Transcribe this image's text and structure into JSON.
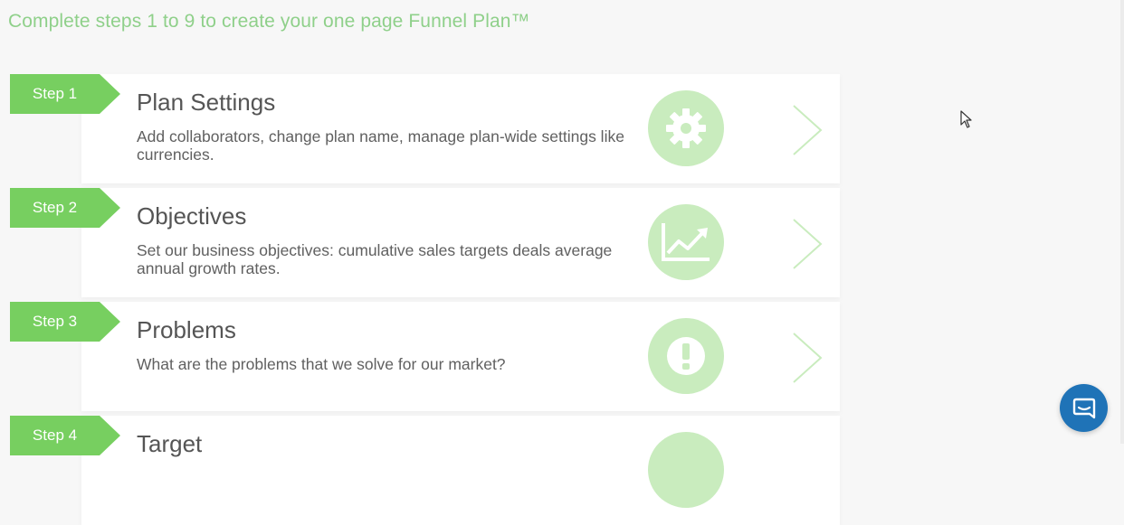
{
  "header": {
    "text": "Complete steps 1 to 9 to create your one page Funnel Plan™"
  },
  "steps": [
    {
      "tag": "Step 1",
      "title": "Plan Settings",
      "description": "Add collaborators, change plan name, manage plan-wide settings like currencies.",
      "icon": "gear-icon"
    },
    {
      "tag": "Step 2",
      "title": "Objectives",
      "description": "Set our business objectives: cumulative sales targets deals average annual growth rates.",
      "icon": "trending-chart-icon"
    },
    {
      "tag": "Step 3",
      "title": "Problems",
      "description": "What are the problems that we solve for our market?",
      "icon": "exclamation-icon"
    },
    {
      "tag": "Step 4",
      "title": "Target",
      "description": "",
      "icon": "target-icon"
    }
  ],
  "colors": {
    "accent_green": "#77cf60",
    "icon_circle": "#c9ecbe",
    "header_green": "#8fd08a",
    "chat_blue": "#1f73b7"
  },
  "chat": {
    "icon": "chat-icon"
  }
}
